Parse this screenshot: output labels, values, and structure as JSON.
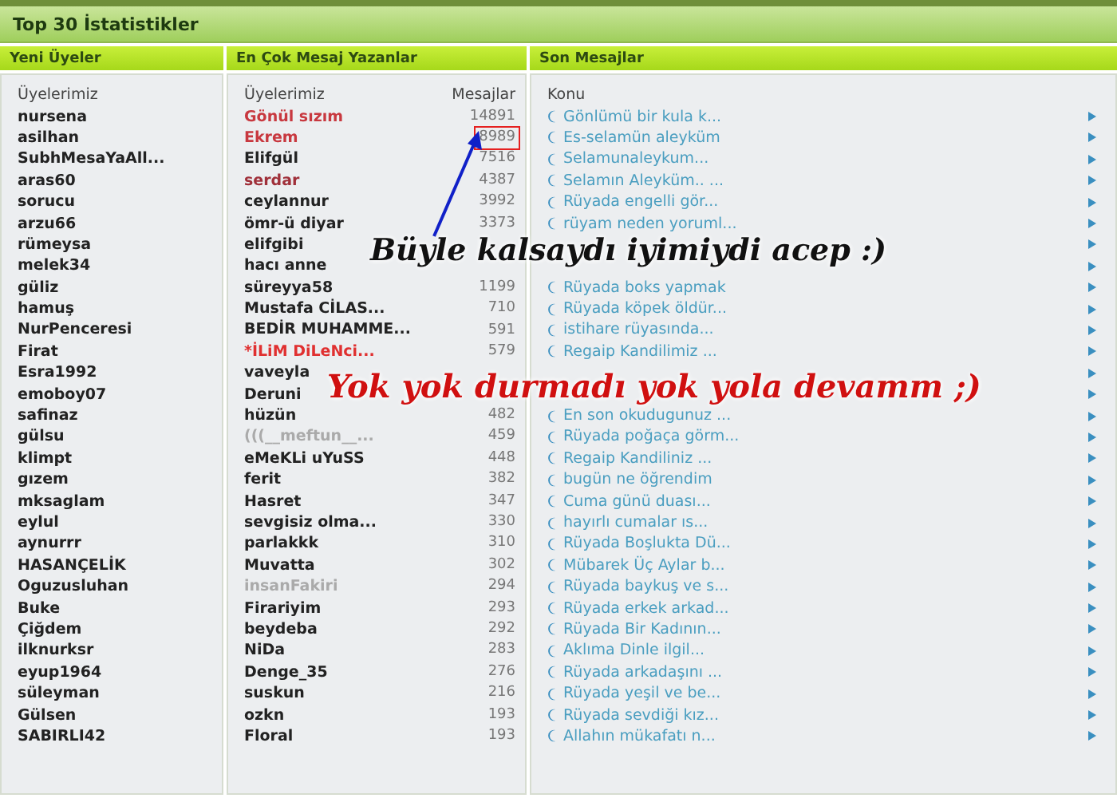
{
  "header": {
    "title": "Top 30 İstatistikler"
  },
  "columns": [
    {
      "title": "Yeni Üyeler"
    },
    {
      "title": "En Çok Mesaj Yazanlar"
    },
    {
      "title": "Son Mesajlar"
    }
  ],
  "new_members": {
    "heading": "Üyelerimiz",
    "items": [
      "nursena",
      "asilhan",
      "SubhMesaYaAll...",
      "aras60",
      "sorucu",
      "arzu66",
      "rümeysa",
      "melek34",
      "güliz",
      "hamuş",
      "NurPenceresi",
      "Firat",
      "Esra1992",
      "emoboy07",
      "safinaz",
      "gülsu",
      "klimpt",
      "gızem",
      "mksaglam",
      "eylul",
      "aynurrr",
      "HASANÇELİK",
      "Oguzusluhan",
      "Buke",
      "Çiğdem",
      "ilknurksr",
      "eyup1964",
      "süleyman",
      "Gülsen",
      "SABIRLI42"
    ]
  },
  "top_posters": {
    "heading": "Üyelerimiz",
    "count_heading": "Mesajlar",
    "rows": [
      {
        "name": "Gönül sızım",
        "count": "14891",
        "color": "#c8383f"
      },
      {
        "name": "Ekrem",
        "count": "8989",
        "color": "#c8383f",
        "highlighted": true
      },
      {
        "name": "Elifgül",
        "count": "7516",
        "color": "#222222"
      },
      {
        "name": "serdar",
        "count": "4387",
        "color": "#a0303a"
      },
      {
        "name": "ceylannur",
        "count": "3992",
        "color": "#222222"
      },
      {
        "name": "ömr-ü diyar",
        "count": "3373",
        "color": "#222222"
      },
      {
        "name": "elifgibi",
        "color": "#222222"
      },
      {
        "name": "hacı anne",
        "color": "#222222"
      },
      {
        "name": "süreyya58",
        "count": "1199",
        "color": "#222222"
      },
      {
        "name": "Mustafa CİLAS...",
        "count": "710",
        "color": "#222222"
      },
      {
        "name": "BEDİR MUHAMME...",
        "count": "591",
        "color": "#222222"
      },
      {
        "name": "*İLiM DiLeNci...",
        "count": "579",
        "color": "#e03030"
      },
      {
        "name": "vaveyla",
        "color": "#222222"
      },
      {
        "name": "Deruni",
        "color": "#222222"
      },
      {
        "name": "hüzün",
        "count": "482",
        "color": "#222222"
      },
      {
        "name": "(((__meftun__...",
        "count": "459",
        "color": "#aaaaaa"
      },
      {
        "name": "eMeKLi uYuSS",
        "count": "448",
        "color": "#222222"
      },
      {
        "name": "ferit",
        "count": "382",
        "color": "#222222"
      },
      {
        "name": "Hasret",
        "count": "347",
        "color": "#222222"
      },
      {
        "name": "sevgisiz olma...",
        "count": "330",
        "color": "#222222"
      },
      {
        "name": "parlakkk",
        "count": "310",
        "color": "#222222"
      },
      {
        "name": "Muvatta",
        "count": "302",
        "color": "#222222"
      },
      {
        "name": "insanFakiri",
        "count": "294",
        "color": "#aaaaaa"
      },
      {
        "name": "Firariyim",
        "count": "293",
        "color": "#222222"
      },
      {
        "name": "beydeba",
        "count": "292",
        "color": "#222222"
      },
      {
        "name": "NiDa",
        "count": "283",
        "color": "#222222"
      },
      {
        "name": "Denge_35",
        "count": "276",
        "color": "#222222"
      },
      {
        "name": "suskun",
        "count": "216",
        "color": "#222222"
      },
      {
        "name": "ozkn",
        "count": "193",
        "color": "#222222"
      },
      {
        "name": "Floral",
        "count": "193",
        "color": "#222222"
      }
    ]
  },
  "latest_posts": {
    "heading": "Konu",
    "blocks": [
      {
        "items": [
          {
            "title": "Gönlümü bir kula k..."
          },
          {
            "title": "Es-selamün aleyküm"
          },
          {
            "title": "Selamunaleykum..."
          },
          {
            "title": "Selamın Aleyküm.. ..."
          },
          {
            "title": "Rüyada engelli gör..."
          },
          {
            "title": "rüyam neden yoruml..."
          }
        ]
      },
      {
        "items": [
          {
            "title": "Rüyada boks yapmak"
          },
          {
            "title": "Rüyada köpek öldür..."
          },
          {
            "title": "istihare rüyasında..."
          },
          {
            "title": "Regaip Kandilimiz ..."
          }
        ]
      },
      {
        "items": [
          {
            "title": "En son okudugunuz ..."
          },
          {
            "title": "Rüyada poğaça görm..."
          },
          {
            "title": "Regaip Kandiliniz ..."
          },
          {
            "title": "bugün ne öğrendim"
          },
          {
            "title": "Cuma günü duası..."
          },
          {
            "title": "hayırlı cumalar ıs..."
          },
          {
            "title": "Rüyada Boşlukta Dü..."
          },
          {
            "title": "Mübarek Üç Aylar b..."
          },
          {
            "title": "Rüyada baykuş ve s..."
          },
          {
            "title": "Rüyada erkek arkad..."
          },
          {
            "title": "Rüyada Bir Kadının..."
          },
          {
            "title": "Aklıma Dinle ilgil..."
          },
          {
            "title": "Rüyada arkadaşını ..."
          },
          {
            "title": "Rüyada yeşil ve be..."
          },
          {
            "title": "Rüyada sevdiği kız..."
          },
          {
            "title": "Allahın mükafatı n..."
          }
        ]
      }
    ]
  },
  "annotations": [
    {
      "kind": "question",
      "text": "Büyle kalsaydı iyimiydi acep :)"
    },
    {
      "kind": "answer",
      "text": "Yok yok durmadı yok yola devamm ;)"
    }
  ]
}
